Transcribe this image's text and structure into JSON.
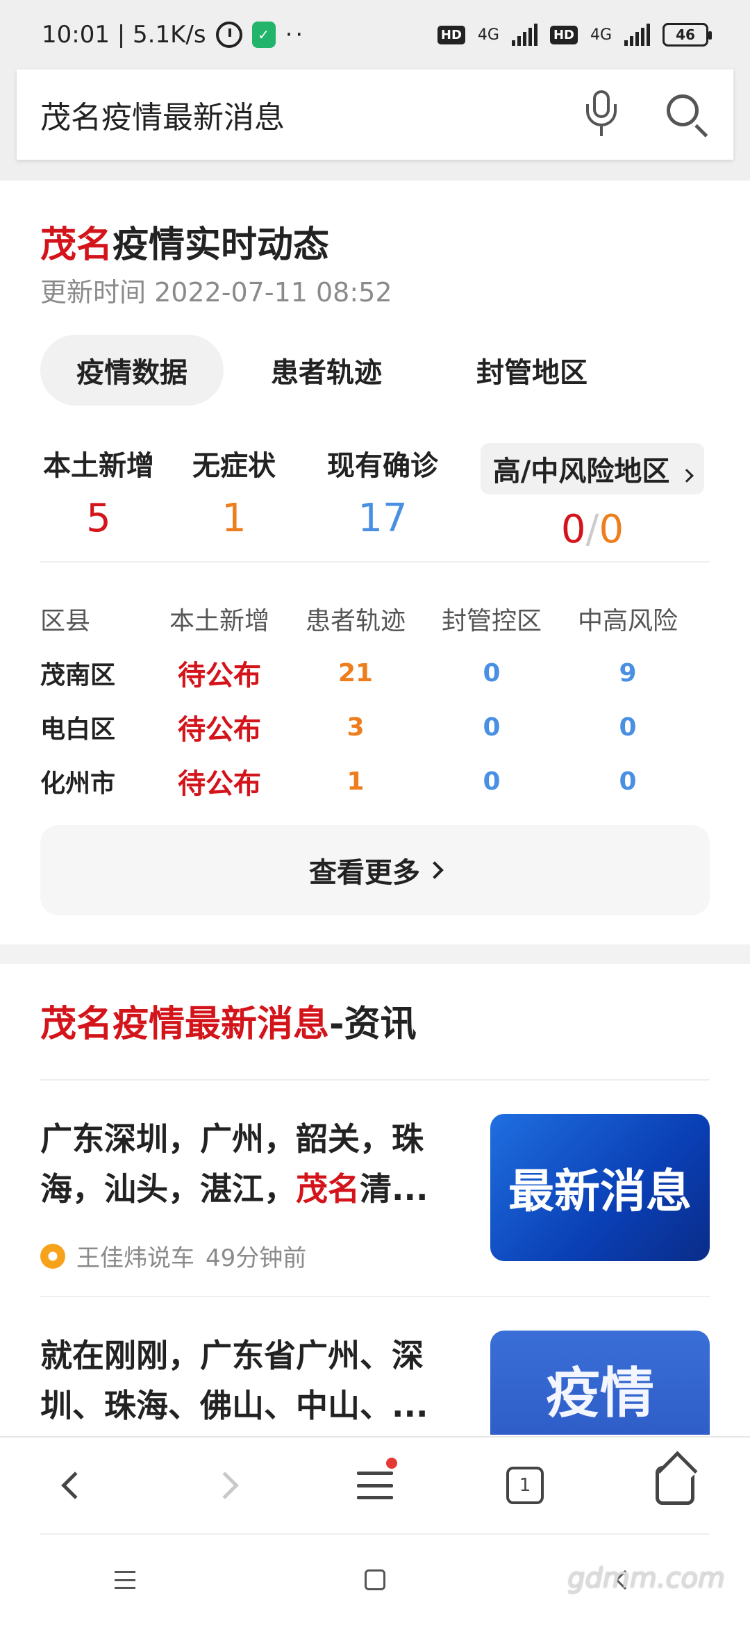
{
  "status_bar": {
    "time_speed": "10:01 | 5.1K/s",
    "alarm_icon": "alarm-clock-icon",
    "shield_icon": "green-shield-icon",
    "dots": "··",
    "hd1": "HD",
    "net1": "4G",
    "hd2": "HD",
    "net2": "4G",
    "battery": "46"
  },
  "search": {
    "query": "茂名疫情最新消息",
    "mic_icon": "microphone-icon",
    "search_icon": "search-icon"
  },
  "card": {
    "title_highlight": "茂名",
    "title_rest": "疫情实时动态",
    "updated": "更新时间 2022-07-11 08:52",
    "tabs": [
      "疫情数据",
      "患者轨迹",
      "封管地区"
    ],
    "stats": [
      {
        "label": "本土新增",
        "value": "5"
      },
      {
        "label": "无症状",
        "value": "1"
      },
      {
        "label": "现有确诊",
        "value": "17"
      },
      {
        "label": "高/中风险地区",
        "value_high": "0",
        "slash": "/",
        "value_mid": "0"
      }
    ],
    "table": {
      "headers": [
        "区县",
        "本土新增",
        "患者轨迹",
        "封管控区",
        "中高风险"
      ],
      "rows": [
        [
          "茂南区",
          "待公布",
          "21",
          "0",
          "9"
        ],
        [
          "电白区",
          "待公布",
          "3",
          "0",
          "0"
        ],
        [
          "化州市",
          "待公布",
          "1",
          "0",
          "0"
        ]
      ]
    },
    "more_button": "查看更多"
  },
  "news": {
    "title_highlight": "茂名疫情最新消息",
    "title_rest": "-资讯",
    "items": [
      {
        "text_line1": "广东深圳，广州，韶关，珠",
        "text_line2_pre": "海，汕头，湛江，",
        "text_line2_hl": "茂名",
        "text_line2_post": "清...",
        "source": "王佳炜说车",
        "time": "49分钟前",
        "thumb_text": "最新消息"
      },
      {
        "text_line1": "就在刚刚，广东省广州、深",
        "text_line2": "圳、珠海、佛山、中山、...",
        "thumb_text": "疫情"
      }
    ]
  },
  "bottom_nav": {
    "tab_count": "1"
  },
  "watermark": "gdmm.com",
  "colors": {
    "accent_red": "#d4141b",
    "orange": "#ee7d1d",
    "blue": "#4a90e2"
  }
}
